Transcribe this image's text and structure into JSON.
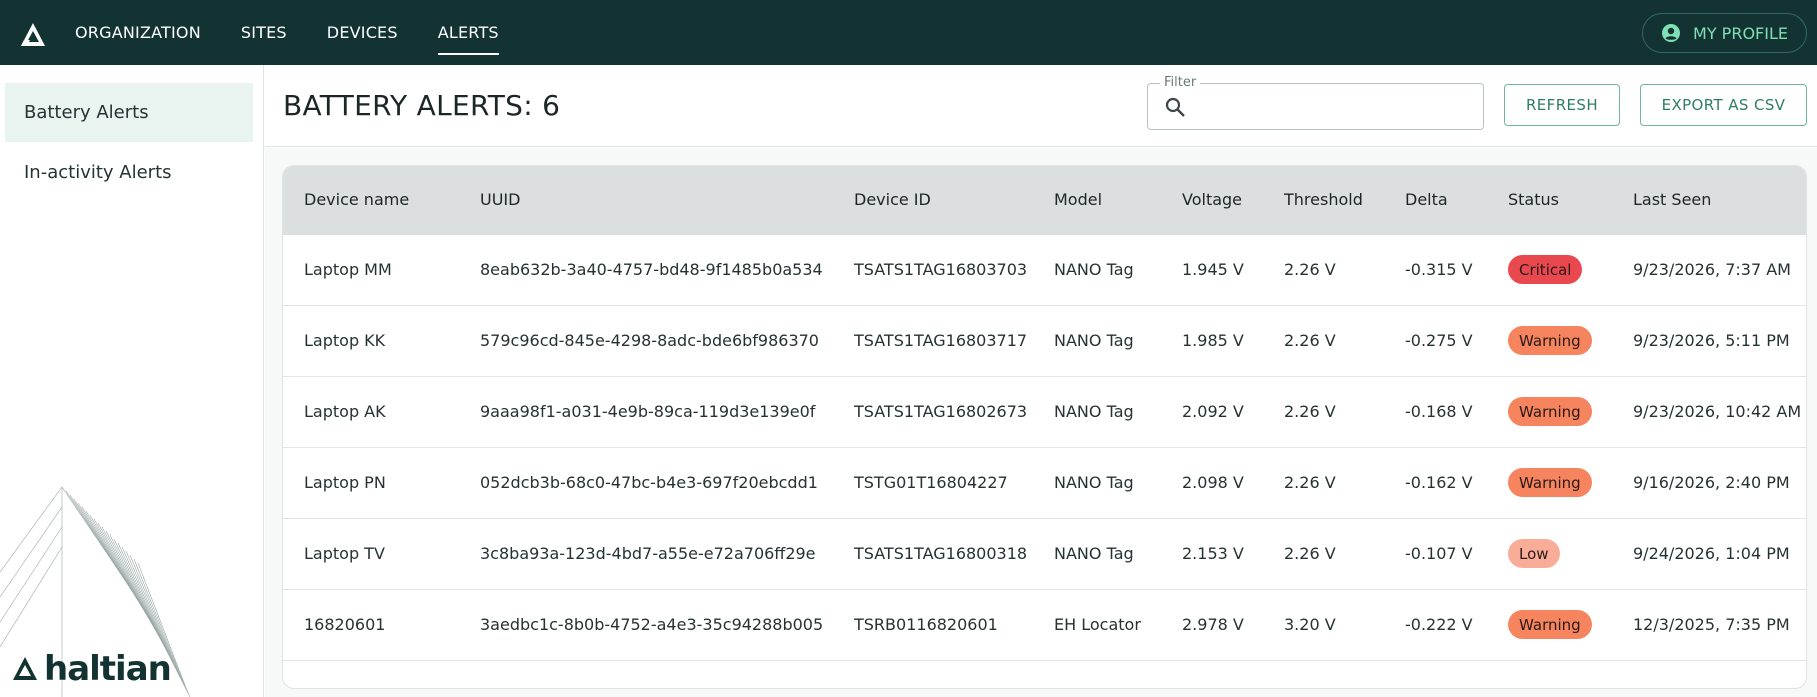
{
  "nav": {
    "items": [
      {
        "label": "ORGANIZATION"
      },
      {
        "label": "SITES"
      },
      {
        "label": "DEVICES"
      },
      {
        "label": "ALERTS"
      }
    ],
    "active": "ALERTS",
    "profile_label": "MY PROFILE"
  },
  "sidebar": {
    "items": [
      {
        "label": "Battery Alerts",
        "active": true
      },
      {
        "label": "In-activity Alerts",
        "active": false
      }
    ],
    "brand": "haltian"
  },
  "header": {
    "title": "BATTERY ALERTS: 6",
    "filter_label": "Filter",
    "filter_value": "",
    "refresh_label": "REFRESH",
    "export_label": "EXPORT AS CSV"
  },
  "table": {
    "columns": [
      "Device name",
      "UUID",
      "Device ID",
      "Model",
      "Voltage",
      "Threshold",
      "Delta",
      "Status",
      "Last Seen"
    ],
    "rows": [
      [
        "Laptop MM",
        "8eab632b-3a40-4757-bd48-9f1485b0a534",
        "TSATS1TAG16803703",
        "NANO Tag",
        "1.945 V",
        "2.26 V",
        "-0.315 V",
        "Critical",
        "9/23/2026, 7:37 AM"
      ],
      [
        "Laptop KK",
        "579c96cd-845e-4298-8adc-bde6bf986370",
        "TSATS1TAG16803717",
        "NANO Tag",
        "1.985 V",
        "2.26 V",
        "-0.275 V",
        "Warning",
        "9/23/2026, 5:11 PM"
      ],
      [
        "Laptop AK",
        "9aaa98f1-a031-4e9b-89ca-119d3e139e0f",
        "TSATS1TAG16802673",
        "NANO Tag",
        "2.092 V",
        "2.26 V",
        "-0.168 V",
        "Warning",
        "9/23/2026, 10:42 AM"
      ],
      [
        "Laptop PN",
        "052dcb3b-68c0-47bc-b4e3-697f20ebcdd1",
        "TSTG01T16804227",
        "NANO Tag",
        "2.098 V",
        "2.26 V",
        "-0.162 V",
        "Warning",
        "9/16/2026, 2:40 PM"
      ],
      [
        "Laptop TV",
        "3c8ba93a-123d-4bd7-a55e-e72a706ff29e",
        "TSATS1TAG16800318",
        "NANO Tag",
        "2.153 V",
        "2.26 V",
        "-0.107 V",
        "Low",
        "9/24/2026, 1:04 PM"
      ],
      [
        "16820601",
        "3aedbc1c-8b0b-4752-a4e3-35c94288b005",
        "TSRB0116820601",
        "EH Locator",
        "2.978 V",
        "3.20 V",
        "-0.222 V",
        "Warning",
        "12/3/2025, 7:35 PM"
      ]
    ]
  },
  "colors": {
    "topbar": "#123332",
    "accent": "#7fe0b4",
    "critical": "#e9484e",
    "warning": "#f6845f",
    "low": "#f9ad98"
  },
  "icons": {
    "logo": "haltian-logo-icon",
    "profile": "account-circle-icon",
    "search": "search-icon"
  }
}
